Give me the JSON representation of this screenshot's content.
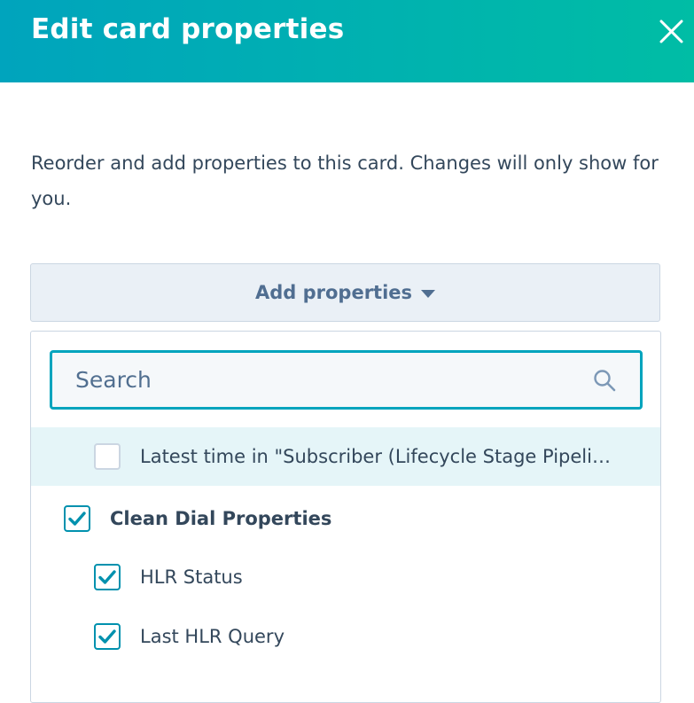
{
  "modal": {
    "title": "Edit card properties",
    "close_icon": "close-icon",
    "description": "Reorder and add properties to this card. Changes will only show for you."
  },
  "add_properties": {
    "label": "Add properties",
    "icon": "caret-down-icon"
  },
  "dropdown": {
    "search": {
      "placeholder": "Search",
      "value": "",
      "icon": "search-icon"
    },
    "items": [
      {
        "label": "Latest time in \"Subscriber (Lifecycle Stage Pipeli…",
        "checked": false,
        "group": false,
        "highlighted": true
      },
      {
        "label": "Clean Dial Properties",
        "checked": true,
        "group": true,
        "highlighted": false
      },
      {
        "label": "HLR Status",
        "checked": true,
        "group": false,
        "highlighted": false
      },
      {
        "label": "Last HLR Query",
        "checked": true,
        "group": false,
        "highlighted": false
      }
    ]
  },
  "colors": {
    "header_gradient_start": "#00a4bd",
    "header_gradient_end": "#00bda5",
    "accent": "#0091ae",
    "text": "#33475b",
    "highlight_row": "#e5f5f8"
  }
}
